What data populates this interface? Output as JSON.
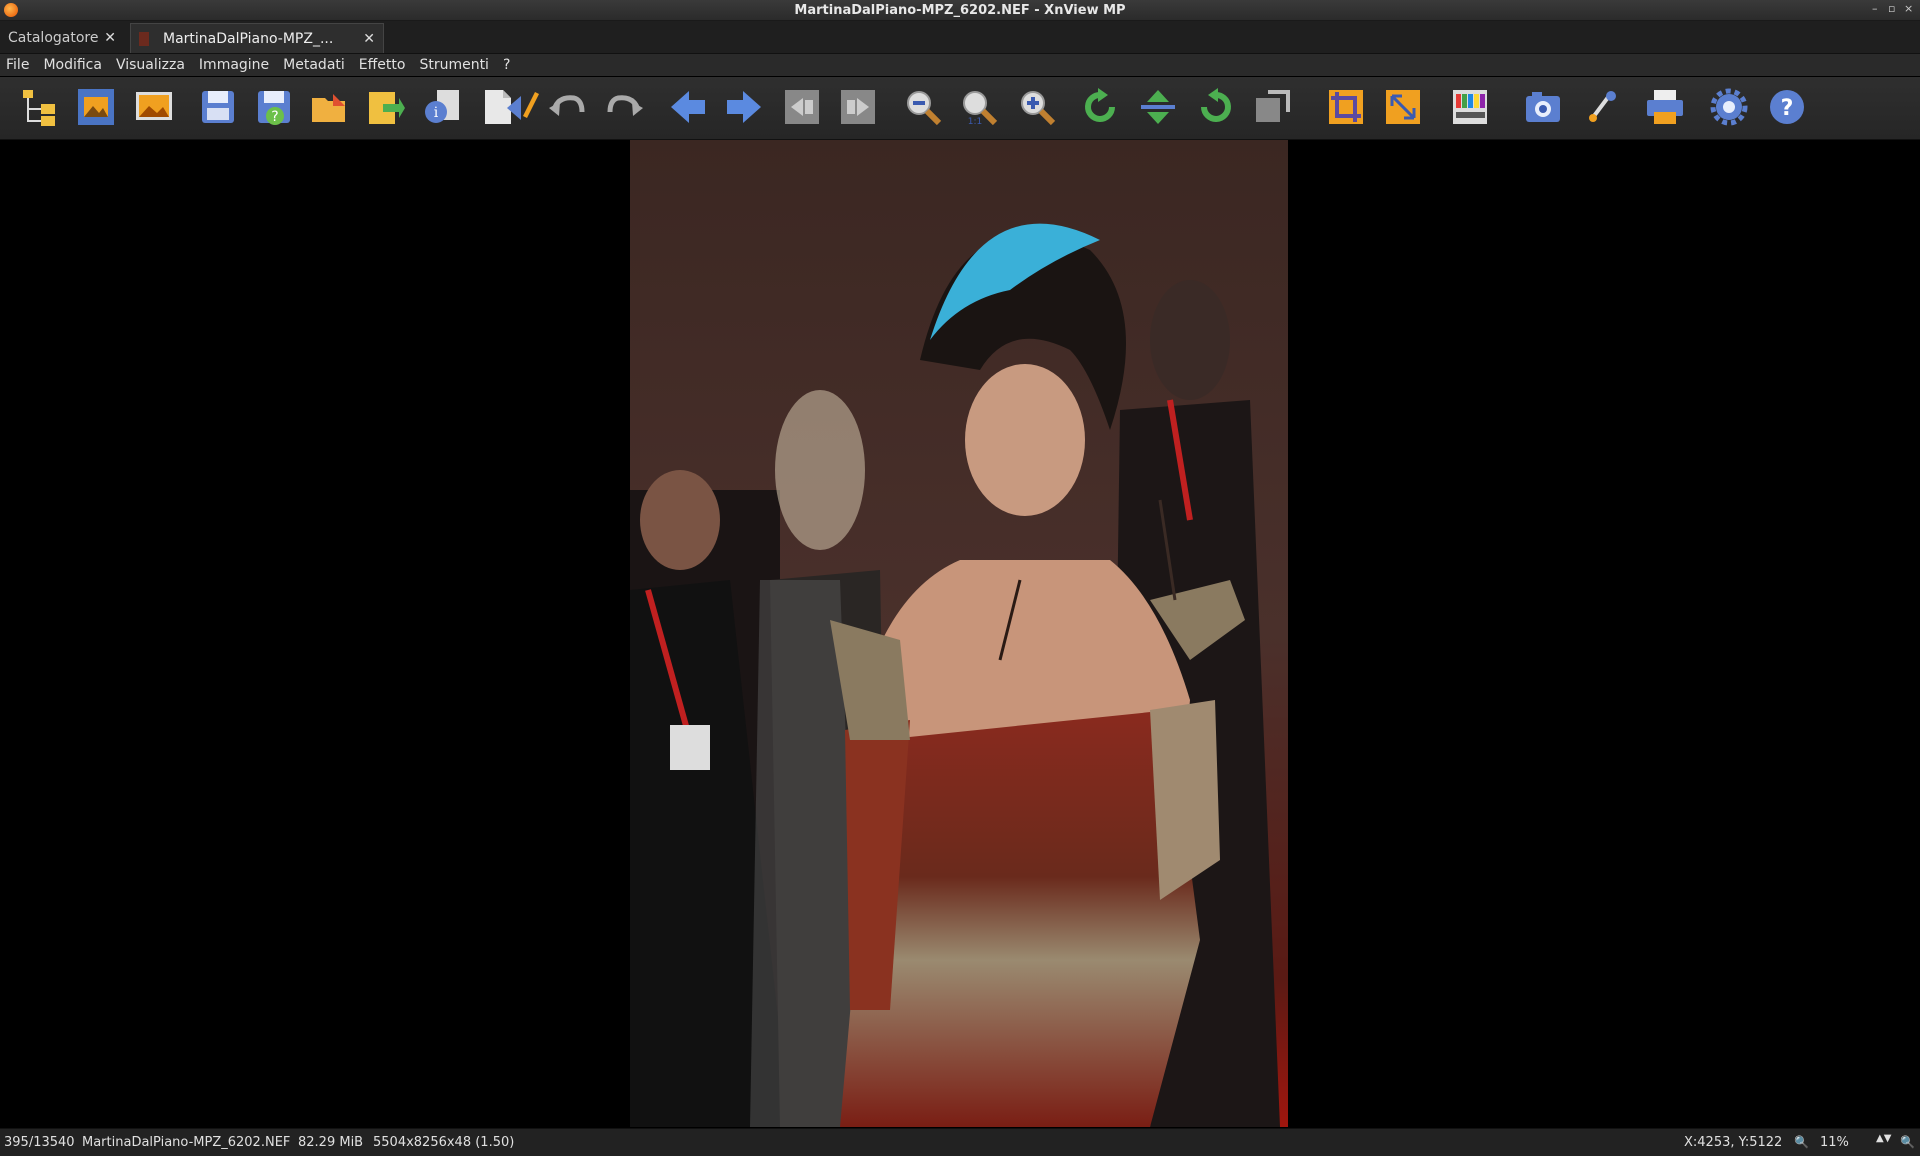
{
  "window": {
    "title": "MartinaDalPiano-MPZ_6202.NEF - XnView MP",
    "controls": [
      "–",
      "▫",
      "×"
    ]
  },
  "tabs": [
    {
      "label": "Catalogatore",
      "close": "✕",
      "active": false
    },
    {
      "label": "MartinaDalPiano-MPZ_...",
      "close": "✕",
      "active": true
    }
  ],
  "menu": {
    "items": [
      {
        "label": "File",
        "underline": "F"
      },
      {
        "label": "Modifica",
        "underline": "M"
      },
      {
        "label": "Visualizza",
        "underline": "V"
      },
      {
        "label": "Immagine",
        "underline": "I"
      },
      {
        "label": "Metadati",
        "underline": "M"
      },
      {
        "label": "Effetto",
        "underline": "E"
      },
      {
        "label": "Strumenti",
        "underline": "S"
      },
      {
        "label": "?",
        "underline": "?"
      }
    ]
  },
  "toolbar": {
    "icons": [
      "browser-icon",
      "fullscreen-icon",
      "set-wallpaper-icon",
      "save-icon",
      "save-as-icon",
      "open-with-icon",
      "export-icon",
      "properties-icon",
      "page-icon",
      "edit-icon",
      "undo-icon",
      "redo-icon",
      "previous-icon",
      "next-icon",
      "first-icon",
      "last-icon",
      "zoom-out-icon",
      "zoom-1to1-icon",
      "zoom-in-icon",
      "rotate-left-icon",
      "flip-icon",
      "rotate-right-icon",
      "transform-icon",
      "crop-icon",
      "resize-icon",
      "adjust-colors-icon",
      "capture-icon",
      "effects-icon",
      "print-icon",
      "settings-icon",
      "help-icon"
    ]
  },
  "colors": {
    "accent_blue": "#4a74c4",
    "accent_orange": "#f0a020",
    "background": "#000000"
  },
  "status": {
    "position": "395/13540",
    "filename": "MartinaDalPiano-MPZ_6202.NEF",
    "filesize": "82.29 MiB",
    "dimensions": "5504x8256x48 (1.50)",
    "coords": "X:4253, Y:5122",
    "zoom": "11%"
  }
}
